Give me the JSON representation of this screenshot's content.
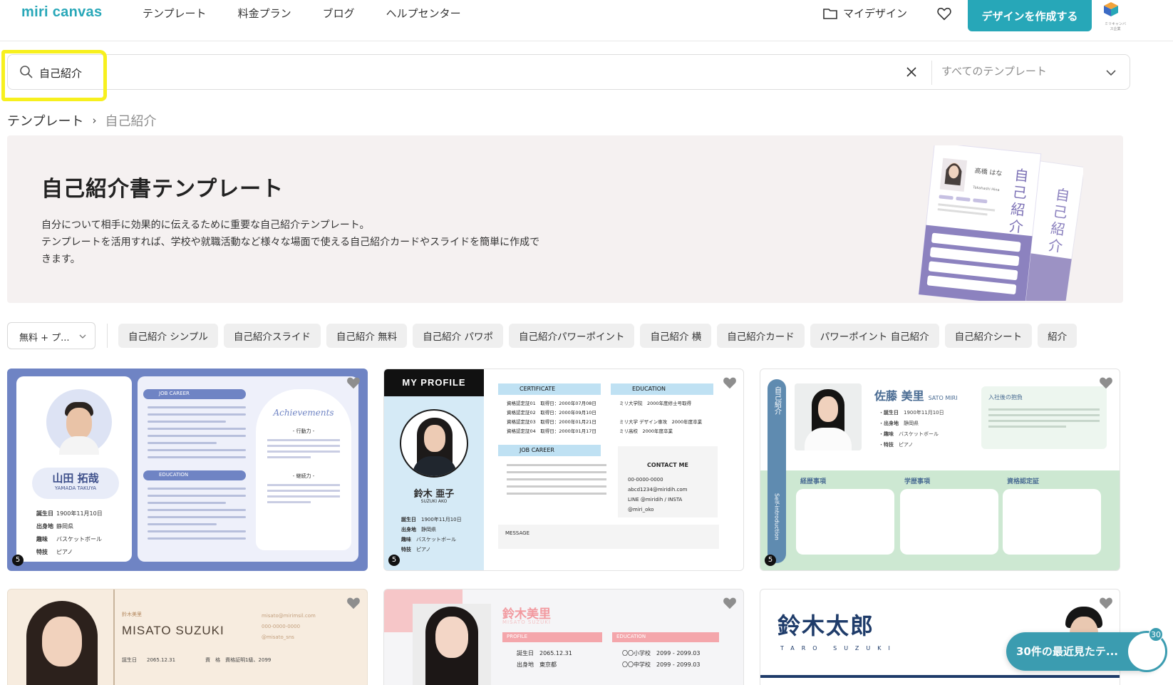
{
  "header": {
    "logo": "miri canvas",
    "nav": [
      "テンプレート",
      "料金プラン",
      "ブログ",
      "ヘルプセンター"
    ],
    "my_design": "マイデザイン",
    "create_button": "デザインを作成する",
    "brand_caption": "ミリキャンバス企業"
  },
  "search": {
    "query": "自己紹介",
    "scope": "すべてのテンプレート"
  },
  "breadcrumb": {
    "root": "テンプレート",
    "separator": "›",
    "current": "自己紹介"
  },
  "hero": {
    "title": "自己紹介書テンプレート",
    "line1": "自分について相手に効果的に伝えるために重要な自己紹介テンプレート。",
    "line2": "テンプレートを活用すれば、学校や就職活動など様々な場面で使える自己紹介カードやスライドを簡単に作成で",
    "line3": "きます。",
    "art_name": "高橋 はな",
    "art_name_en": "Takahashi Hina",
    "art_vertical": "自己紹介"
  },
  "filters": {
    "price": "無料 + プ...",
    "chips": [
      "自己紹介 シンプル",
      "自己紹介スライド",
      "自己紹介 無料",
      "自己紹介 パワポ",
      "自己紹介パワーポイント",
      "自己紹介 横",
      "自己紹介カード",
      "パワーポイント 自己紹介",
      "自己紹介シート",
      "紹介"
    ]
  },
  "cards": {
    "c1": {
      "badge": "5",
      "name": "山田 拓哉",
      "name_en": "YAMADA TAKUYA",
      "job_career": "JOB CAREER",
      "education": "EDUCATION",
      "achievements": "Achievements",
      "birthday_label": "誕生日",
      "birthday": "1900年11月10日",
      "from_label": "出身地",
      "from": "静岡県",
      "hobby_label": "趣味",
      "hobby": "バスケットボール",
      "skill_label": "特技",
      "skill": "ピアノ",
      "ach1": "- 行動力 -",
      "ach2": "- 継続力 -"
    },
    "c2": {
      "badge": "5",
      "title": "MY PROFILE",
      "name": "鈴木 亜子",
      "name_en": "SUZUKI AKO",
      "certificate": "CERTIFICATE",
      "education": "EDUCATION",
      "job_career": "JOB CAREER",
      "contact": "CONTACT ME",
      "phone": "00-0000-0000",
      "email": "abcd1234@miridih.com",
      "sns": "LINE @miridih / INSTA @miri_oko",
      "message": "MESSAGE",
      "birthday_label": "誕生日",
      "birthday": "1900年11月10日",
      "from_label": "出身地",
      "from": "静岡県",
      "hobby_label": "趣味",
      "hobby": "バスケットボール",
      "skill_label": "特技",
      "skill": "ピアノ",
      "cert1": "資格認定証01　取得日：2000年07月08日",
      "cert2": "資格認定証02　取得日：2000年09月10日",
      "cert3": "資格認定証03　取得日：2000年01月21日",
      "cert4": "資格認定証04　取得日：2000年01月17日",
      "edu1": "ミリ大学院　2000年度修士号取得",
      "edu2": "ミリ大学 デザイン専攻　2000年度卒業",
      "edu3": "ミリ高校　2000年度卒業"
    },
    "c3": {
      "badge": "5",
      "vertical": "自己紹介",
      "vertical_en": "Self-introduction",
      "name": "佐藤 美里",
      "name_en": "SATO MIRI",
      "note_title": "入社後の抱負",
      "birthday_label": "誕生日",
      "birthday": "1900年11月10日",
      "from_label": "出身地",
      "from": "静岡県",
      "hobby_label": "趣味",
      "hobby": "バスケットボール",
      "skill_label": "特技",
      "skill": "ピアノ",
      "col1": "経歴事項",
      "col2": "学歴事項",
      "col3": "資格認定証"
    },
    "c4": {
      "small": "鈴木美里",
      "name": "MISATO SUZUKI",
      "mail": "misato@mirimsil.com",
      "phone": "000-0000-0000",
      "sns": "@misato_sns",
      "birthday_label": "誕生日",
      "birthday": "2065.12.31",
      "qual_label": "資　格",
      "qual": "資格証明1級、2099"
    },
    "c5": {
      "name": "鈴木美里",
      "name_en": "MISATO SUZUKI",
      "profile": "PROFILE",
      "education": "EDUCATION",
      "birthday_label": "誕生日",
      "birthday": "2065.12.31",
      "from_label": "出身地",
      "from": "東京都",
      "edu1": "〇〇小学校　2099 - 2099.03",
      "edu2": "〇〇中学校　2099 - 2099.03"
    },
    "c6": {
      "name": "鈴木太郎",
      "name_en": "TARO SUZUKI"
    }
  },
  "recent": {
    "label": "30件の最近見たテ...",
    "count": "30"
  }
}
